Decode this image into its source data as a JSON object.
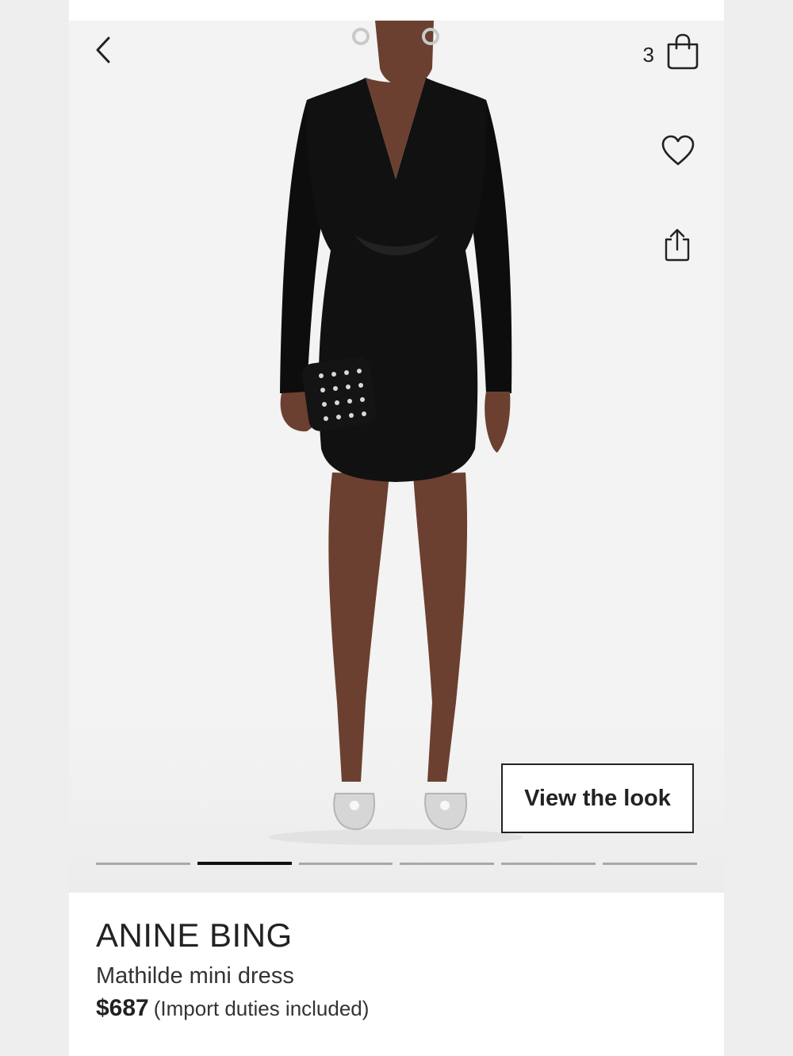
{
  "header": {
    "back_icon": "chevron-left-icon",
    "bag_icon": "shopping-bag-icon",
    "bag_count": "3"
  },
  "actions": {
    "wishlist_icon": "heart-icon",
    "share_icon": "share-icon"
  },
  "hero": {
    "view_look_label": "View the look",
    "pager": {
      "count": 6,
      "active_index": 1
    }
  },
  "product": {
    "brand": "ANINE BING",
    "name": "Mathilde mini dress",
    "price": "$687",
    "duties_note": "(Import duties included)"
  }
}
